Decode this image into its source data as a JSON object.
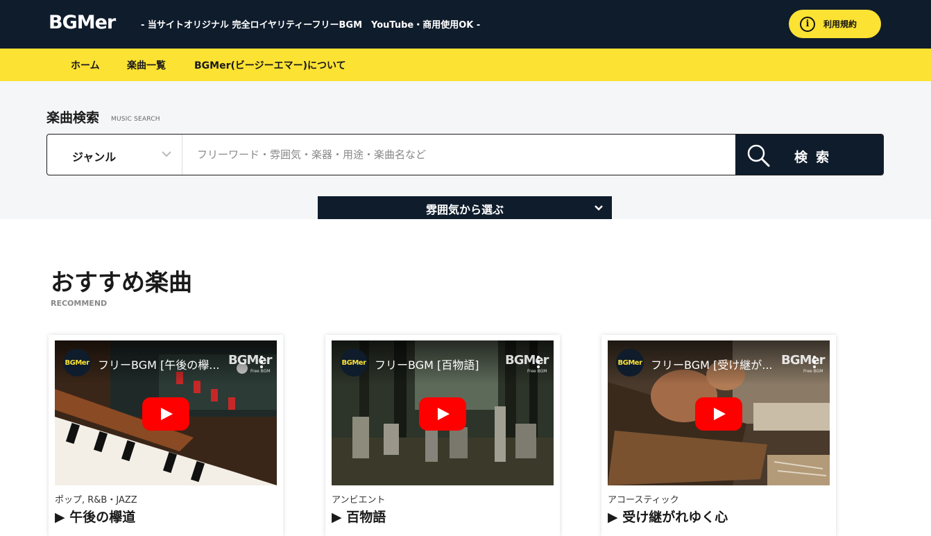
{
  "header": {
    "logo": "BGMer",
    "tagline": "- 当サイトオリジナル 完全ロイヤリティーフリーBGM　YouTube・商用使用OK -",
    "terms_icon": "i",
    "terms_label": "利用規約"
  },
  "nav": {
    "items": [
      {
        "label": "ホーム"
      },
      {
        "label": "楽曲一覧"
      },
      {
        "label": "BGMer(ビージーエマー)について"
      }
    ]
  },
  "search": {
    "title": "楽曲検索",
    "subtitle": "MUSIC SEARCH",
    "genre_label": "ジャンル",
    "placeholder": "フリーワード・雰囲気・楽器・用途・楽曲名など",
    "button_label": "検索",
    "mood_label": "雰囲気から選ぶ"
  },
  "recommend": {
    "title": "おすすめ楽曲",
    "subtitle": "RECOMMEND",
    "cards": [
      {
        "genre": "ポップ, R&B・JAZZ",
        "title": "▶ 午後の欅道",
        "video_title": "フリーBGM [午後の欅...",
        "channel": "BGMer",
        "watermark": "BGMer",
        "watermark_sub": "Free BGM"
      },
      {
        "genre": "アンビエント",
        "title": "▶ 百物語",
        "video_title": "フリーBGM [百物語]",
        "channel": "BGMer",
        "watermark": "BGMer",
        "watermark_sub": "Free BGM"
      },
      {
        "genre": "アコースティック",
        "title": "▶ 受け継がれゆく心",
        "video_title": "フリーBGM [受け継が...",
        "channel": "BGMer",
        "watermark": "BGMer",
        "watermark_sub": "Free BGM"
      }
    ]
  },
  "colors": {
    "navy": "#0f1c2c",
    "yellow": "#fce233",
    "youtube_red": "#ff0000"
  }
}
